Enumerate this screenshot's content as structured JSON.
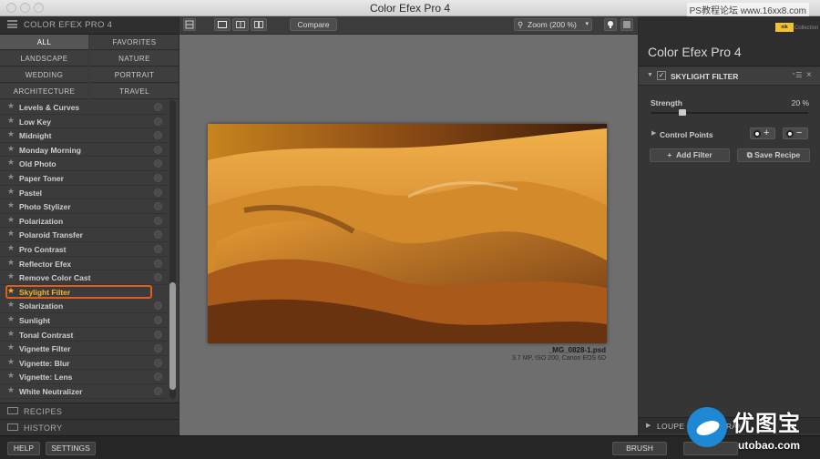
{
  "window": {
    "title": "Color Efex Pro 4",
    "watermark": "PS教程论坛 www.16xx8.com"
  },
  "left_panel": {
    "header": "COLOR EFEX PRO 4",
    "categories": [
      "ALL",
      "FAVORITES",
      "LANDSCAPE",
      "NATURE",
      "WEDDING",
      "PORTRAIT",
      "ARCHITECTURE",
      "TRAVEL"
    ],
    "active_category": "ALL",
    "filters": [
      {
        "name": "Levels & Curves"
      },
      {
        "name": "Low Key"
      },
      {
        "name": "Midnight"
      },
      {
        "name": "Monday Morning"
      },
      {
        "name": "Old Photo"
      },
      {
        "name": "Paper Toner"
      },
      {
        "name": "Pastel"
      },
      {
        "name": "Photo Stylizer"
      },
      {
        "name": "Polarization"
      },
      {
        "name": "Polaroid Transfer"
      },
      {
        "name": "Pro Contrast"
      },
      {
        "name": "Reflector Efex"
      },
      {
        "name": "Remove Color Cast"
      },
      {
        "name": "Skylight Filter",
        "selected": true
      },
      {
        "name": "Solarization"
      },
      {
        "name": "Sunlight"
      },
      {
        "name": "Tonal Contrast"
      },
      {
        "name": "Vignette Filter"
      },
      {
        "name": "Vignette: Blur"
      },
      {
        "name": "Vignette: Lens"
      },
      {
        "name": "White Neutralizer"
      }
    ],
    "recipes_label": "RECIPES",
    "history_label": "HISTORY"
  },
  "toolbar": {
    "compare_label": "Compare",
    "zoom_label": "Zoom (200 %)"
  },
  "image": {
    "filename": "_MG_0828-1.psd",
    "info": "3.7 MP, ISO 200, Canon EOS 6D"
  },
  "right_panel": {
    "brand": "nik",
    "collection": "Collection",
    "title": "Color Efex Pro 4",
    "filter_name": "SKYLIGHT FILTER",
    "strength_label": "Strength",
    "strength_value": "20 %",
    "strength_percent": 20,
    "control_points_label": "Control Points",
    "add_filter_label": "Add Filter",
    "save_recipe_label": "Save Recipe",
    "loupe_label": "LOUPE & HISTOGRAM"
  },
  "bottom_bar": {
    "help_label": "HELP",
    "settings_label": "SETTINGS",
    "brush_label": "BRUSH"
  },
  "logo": {
    "cn": "优图宝",
    "en": "utobao.com"
  }
}
